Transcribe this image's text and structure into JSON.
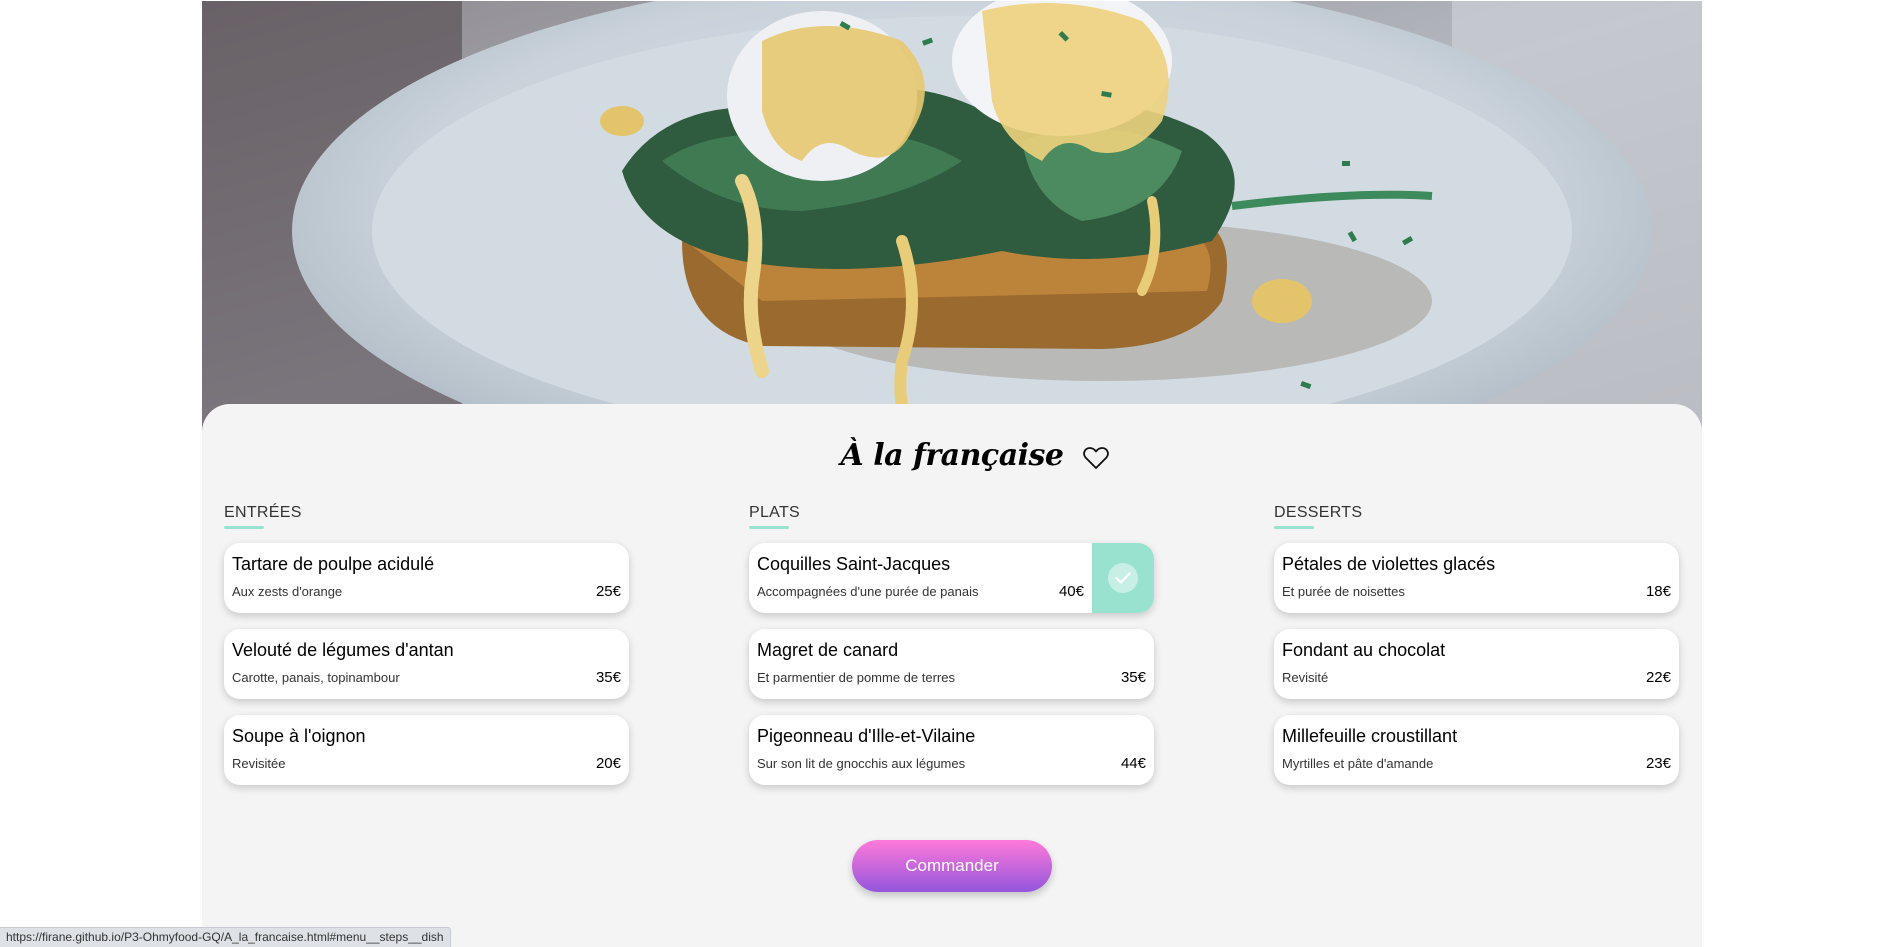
{
  "menu": {
    "title": "À la française",
    "sections": [
      {
        "title": "ENTRÉES",
        "dishes": [
          {
            "name": "Tartare de poulpe acidulé",
            "desc": "Aux zests d'orange",
            "price": "25€"
          },
          {
            "name": "Velouté de légumes d'antan",
            "desc": "Carotte, panais, topinambour",
            "price": "35€"
          },
          {
            "name": "Soupe à l'oignon",
            "desc": "Revisitée",
            "price": "20€"
          }
        ]
      },
      {
        "title": "PLATS",
        "dishes": [
          {
            "name": "Coquilles Saint-Jacques",
            "desc": "Accompagnées d'une purée de panais",
            "price": "40€",
            "selected": true
          },
          {
            "name": "Magret de canard",
            "desc": "Et parmentier de pomme de terres",
            "price": "35€"
          },
          {
            "name": "Pigeonneau d'Ille-et-Vilaine",
            "desc": "Sur son lit de gnocchis aux légumes",
            "price": "44€"
          }
        ]
      },
      {
        "title": "DESSERTS",
        "dishes": [
          {
            "name": "Pétales de violettes glacés",
            "desc": "Et purée de noisettes",
            "price": "18€"
          },
          {
            "name": "Fondant au chocolat",
            "desc": "Revisité",
            "price": "22€"
          },
          {
            "name": "Millefeuille croustillant",
            "desc": "Myrtilles et pâte d'amande",
            "price": "23€"
          }
        ]
      }
    ],
    "order_button": "Commander"
  },
  "status_bar": {
    "url": "https://firane.github.io/P3-Ohmyfood-GQ/A_la_francaise.html#menu__steps__dish"
  },
  "colors": {
    "accent_mint": "#99e2d0",
    "button_gradient_top": "#ff79da",
    "button_gradient_bottom": "#9356dc",
    "background": "#f4f4f4"
  },
  "icons": {
    "favorite": "heart-outline-icon",
    "selected": "check-icon"
  }
}
